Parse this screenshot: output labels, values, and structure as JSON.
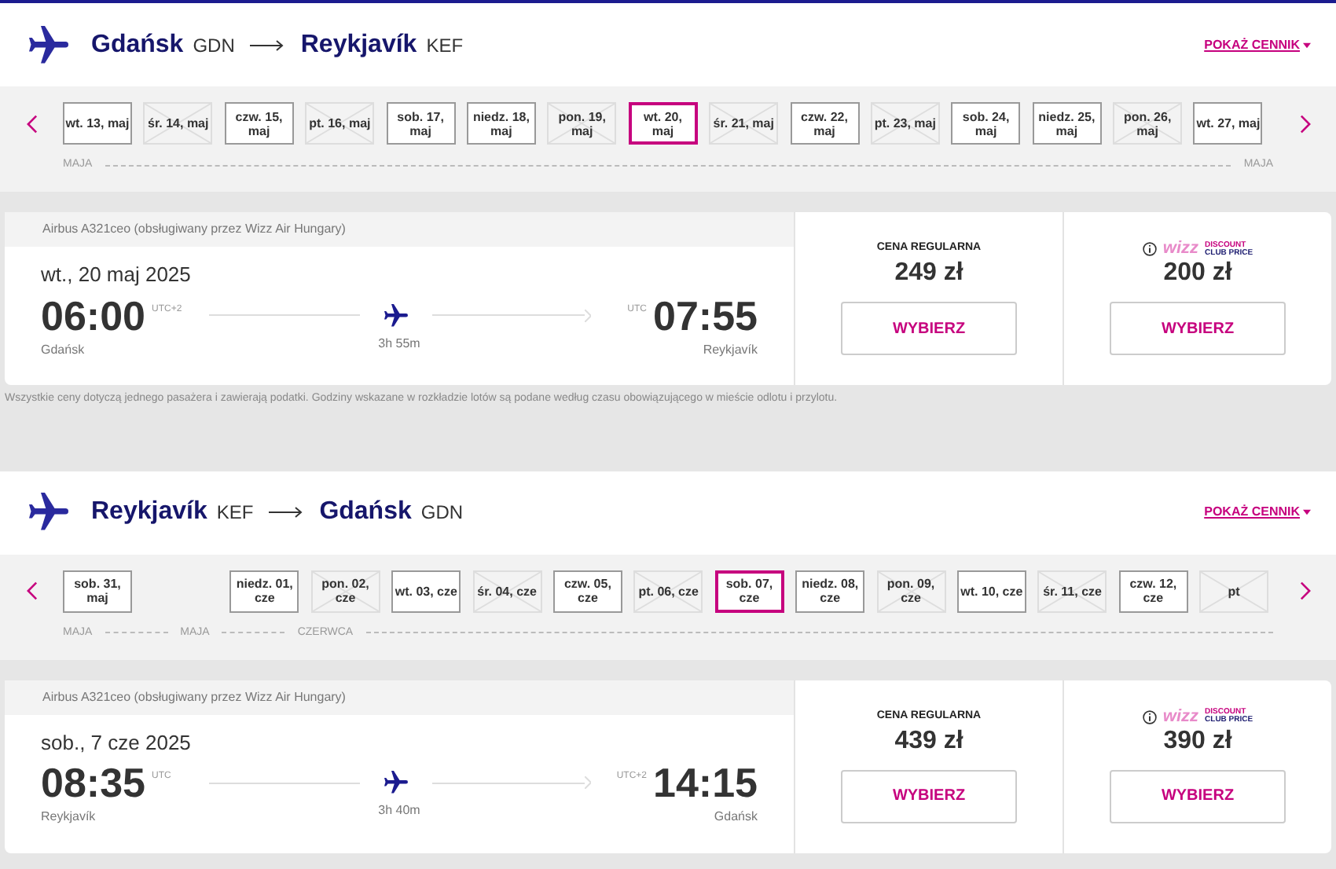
{
  "sections": [
    {
      "route": {
        "from_city": "Gdańsk",
        "from_code": "GDN",
        "to_city": "Reykjavík",
        "to_code": "KEF"
      },
      "show_prices": "POKAŻ CENNIK",
      "dates": [
        {
          "label": "wt. 13, maj",
          "available": true,
          "selected": false
        },
        {
          "label": "śr. 14, maj",
          "available": false,
          "selected": false
        },
        {
          "label": "czw. 15, maj",
          "available": true,
          "selected": false
        },
        {
          "label": "pt. 16, maj",
          "available": false,
          "selected": false
        },
        {
          "label": "sob. 17, maj",
          "available": true,
          "selected": false
        },
        {
          "label": "niedz. 18, maj",
          "available": true,
          "selected": false
        },
        {
          "label": "pon. 19, maj",
          "available": false,
          "selected": false
        },
        {
          "label": "wt. 20, maj",
          "available": true,
          "selected": true
        },
        {
          "label": "śr. 21, maj",
          "available": false,
          "selected": false
        },
        {
          "label": "czw. 22, maj",
          "available": true,
          "selected": false
        },
        {
          "label": "pt. 23, maj",
          "available": false,
          "selected": false
        },
        {
          "label": "sob. 24, maj",
          "available": true,
          "selected": false
        },
        {
          "label": "niedz. 25, maj",
          "available": true,
          "selected": false
        },
        {
          "label": "pon. 26, maj",
          "available": false,
          "selected": false
        },
        {
          "label": "wt. 27, maj",
          "available": true,
          "selected": false
        }
      ],
      "months": [
        {
          "label": "MAJA",
          "kind": "start"
        },
        {
          "label": "MAJA",
          "kind": "end"
        }
      ],
      "flight": {
        "aircraft": "Airbus A321ceo (obsługiwany przez Wizz Air Hungary)",
        "date": "wt., 20 maj 2025",
        "dep_time": "06:00",
        "dep_tz": "UTC+2",
        "dep_city": "Gdańsk",
        "duration": "3h 55m",
        "arr_tz": "UTC",
        "arr_time": "07:55",
        "arr_city": "Reykjavík",
        "fares": [
          {
            "kind": "regular",
            "title": "CENA REGULARNA",
            "price": "249 zł",
            "button": "WYBIERZ"
          },
          {
            "kind": "club",
            "logo": [
              "wizz",
              "DISCOUNT",
              "CLUB PRICE"
            ],
            "price": "200 zł",
            "button": "WYBIERZ"
          }
        ]
      },
      "note": "Wszystkie ceny dotyczą jednego pasażera i zawierają podatki. Godziny wskazane w rozkładzie lotów są podane według czasu obowiązującego w mieście odlotu i przylotu."
    },
    {
      "route": {
        "from_city": "Reykjavík",
        "from_code": "KEF",
        "to_city": "Gdańsk",
        "to_code": "GDN"
      },
      "show_prices": "POKAŻ CENNIK",
      "dates": [
        {
          "label": "sob. 31, maj",
          "available": true,
          "selected": false
        },
        {
          "label": "niedz. 01, cze",
          "available": true,
          "selected": false,
          "month_start": true
        },
        {
          "label": "pon. 02, cze",
          "available": false,
          "selected": false
        },
        {
          "label": "wt. 03, cze",
          "available": true,
          "selected": false
        },
        {
          "label": "śr. 04, cze",
          "available": false,
          "selected": false
        },
        {
          "label": "czw. 05, cze",
          "available": true,
          "selected": false
        },
        {
          "label": "pt. 06, cze",
          "available": false,
          "selected": false
        },
        {
          "label": "sob. 07, cze",
          "available": true,
          "selected": true
        },
        {
          "label": "niedz. 08, cze",
          "available": true,
          "selected": false
        },
        {
          "label": "pon. 09, cze",
          "available": false,
          "selected": false
        },
        {
          "label": "wt. 10, cze",
          "available": true,
          "selected": false
        },
        {
          "label": "śr. 11, cze",
          "available": false,
          "selected": false
        },
        {
          "label": "czw. 12, cze",
          "available": true,
          "selected": false
        },
        {
          "label": "pt",
          "available": false,
          "selected": false
        }
      ],
      "months": [
        {
          "label": "MAJA",
          "kind": "start"
        },
        {
          "label": "MAJA",
          "kind": "start"
        },
        {
          "label": "CZERWCA",
          "kind": "start"
        }
      ],
      "flight": {
        "aircraft": "Airbus A321ceo (obsługiwany przez Wizz Air Hungary)",
        "date": "sob., 7 cze 2025",
        "dep_time": "08:35",
        "dep_tz": "UTC",
        "dep_city": "Reykjavík",
        "duration": "3h 40m",
        "arr_tz": "UTC+2",
        "arr_time": "14:15",
        "arr_city": "Gdańsk",
        "fares": [
          {
            "kind": "regular",
            "title": "CENA REGULARNA",
            "price": "439 zł",
            "button": "WYBIERZ"
          },
          {
            "kind": "club",
            "logo": [
              "wizz",
              "DISCOUNT",
              "CLUB PRICE"
            ],
            "price": "390 zł",
            "button": "WYBIERZ"
          }
        ]
      }
    }
  ]
}
